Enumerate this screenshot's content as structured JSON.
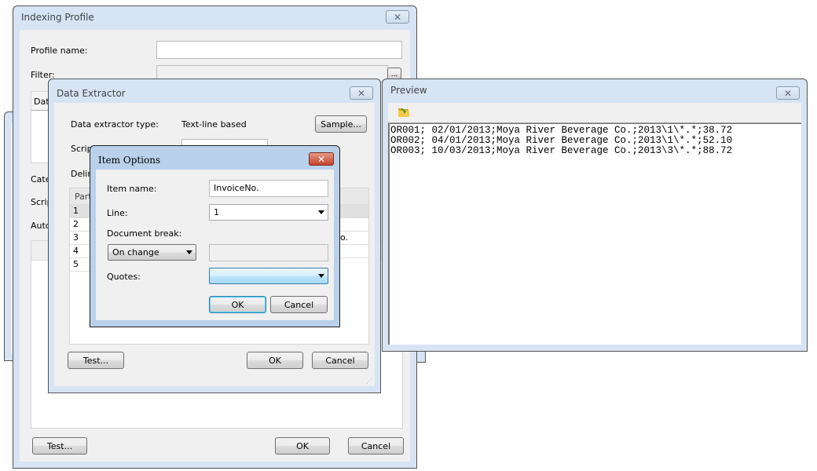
{
  "indexing_profile": {
    "title": "Indexing Profile",
    "close_icon": "close-icon",
    "profile_name_label": "Profile name:",
    "profile_name_value": "",
    "filter_label": "Filter:",
    "filter_value": "",
    "browse_label": "...",
    "list_header_partial": "Dat",
    "category_label_partial": "Cate",
    "script_label_partial": "Scrip",
    "auto_label_partial": "Auto",
    "test_button": "Test...",
    "ok_button": "OK",
    "cancel_button": "Cancel"
  },
  "data_extractor": {
    "title": "Data Extractor",
    "type_label": "Data extractor type:",
    "type_value": "Text-line based",
    "sample_button": "Sample...",
    "script_label_partial": "Script",
    "delim_label_partial": "Delim",
    "table": {
      "header": "Part",
      "rows": [
        "1",
        "2",
        "3",
        "4",
        "5"
      ],
      "row3_partial_text": "o."
    },
    "test_button": "Test...",
    "ok_button": "OK",
    "cancel_button": "Cancel"
  },
  "item_options": {
    "title": "Item Options",
    "item_name_label": "Item name:",
    "item_name_value": "InvoiceNo.",
    "line_label": "Line:",
    "line_value": "1",
    "document_break_label": "Document break:",
    "document_break_value": "On change",
    "document_break_text": "",
    "quotes_label": "Quotes:",
    "quotes_value": "",
    "ok_button": "OK",
    "cancel_button": "Cancel"
  },
  "preview": {
    "title": "Preview",
    "toolbar_icon": "open-folder-icon",
    "lines": [
      "OR001; 02/01/2013;Moya River Beverage Co.;2013\\1\\*.*;38.72",
      "OR002; 04/01/2013;Moya River Beverage Co.;2013\\1\\*.*;52.10",
      "OR003; 10/03/2013;Moya River Beverage Co.;2013\\3\\*.*;88.72"
    ]
  }
}
